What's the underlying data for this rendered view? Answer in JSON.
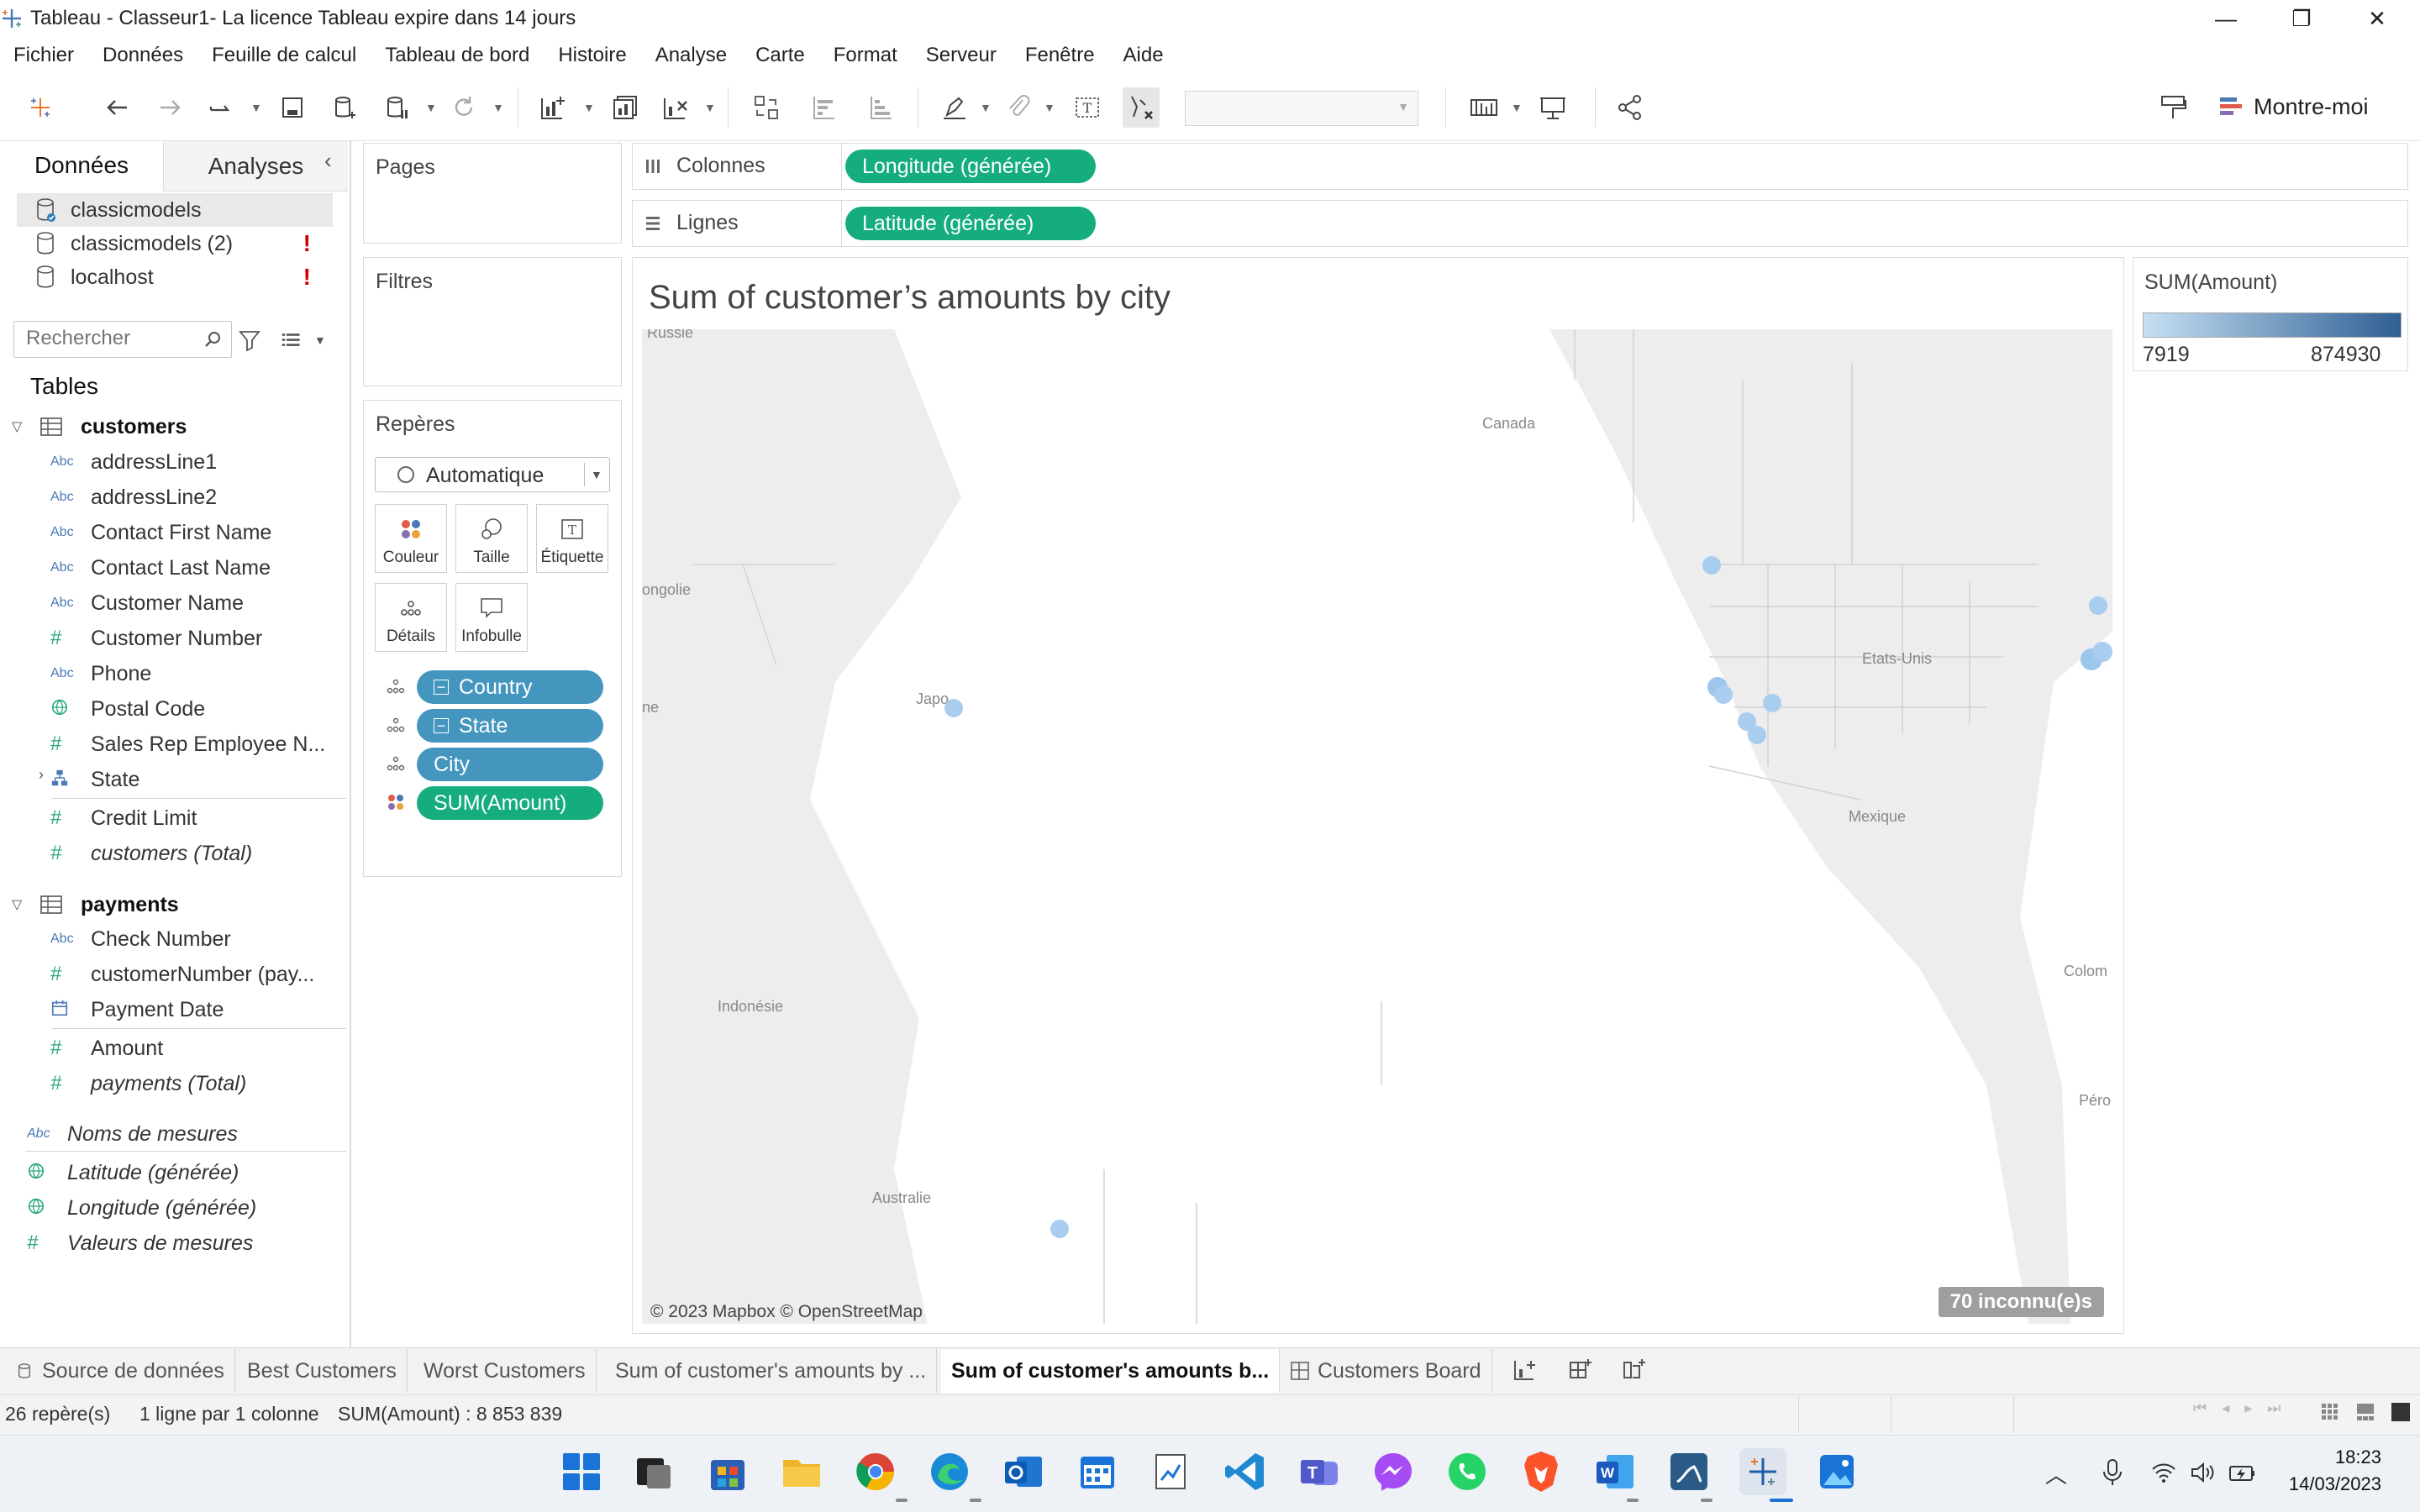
{
  "window": {
    "title": "Tableau - Classeur1- La licence Tableau expire dans 14 jours"
  },
  "menu": [
    "Fichier",
    "Données",
    "Feuille de calcul",
    "Tableau de bord",
    "Histoire",
    "Analyse",
    "Carte",
    "Format",
    "Serveur",
    "Fenêtre",
    "Aide"
  ],
  "toolbar": {
    "show_me": "Montre-moi"
  },
  "left_panel": {
    "tab_data": "Données",
    "tab_analytics": "Analyses",
    "datasources": [
      {
        "name": "classicmodels",
        "selected": true,
        "warning": ""
      },
      {
        "name": "classicmodels (2)",
        "selected": false,
        "warning": "!"
      },
      {
        "name": "localhost",
        "selected": false,
        "warning": "!"
      }
    ],
    "search_placeholder": "Rechercher",
    "tables_label": "Tables",
    "customers": {
      "name": "customers",
      "fields": [
        {
          "type": "Abc",
          "name": "addressLine1"
        },
        {
          "type": "Abc",
          "name": "addressLine2"
        },
        {
          "type": "Abc",
          "name": "Contact First Name"
        },
        {
          "type": "Abc",
          "name": "Contact Last Name"
        },
        {
          "type": "Abc",
          "name": "Customer Name"
        },
        {
          "type": "#",
          "name": "Customer Number"
        },
        {
          "type": "Abc",
          "name": "Phone"
        },
        {
          "type": "globe",
          "name": "Postal Code"
        },
        {
          "type": "#",
          "name": "Sales Rep Employee N..."
        },
        {
          "type": "hier",
          "name": "State"
        }
      ],
      "measures": [
        {
          "type": "#",
          "name": "Credit Limit"
        },
        {
          "type": "#",
          "name": "customers (Total)"
        }
      ]
    },
    "payments": {
      "name": "payments",
      "fields": [
        {
          "type": "Abc",
          "name": "Check Number"
        },
        {
          "type": "#",
          "name": "customerNumber (pay..."
        },
        {
          "type": "date",
          "name": "Payment Date"
        }
      ],
      "measures": [
        {
          "type": "#",
          "name": "Amount"
        },
        {
          "type": "#",
          "name": "payments (Total)"
        }
      ]
    },
    "extra": [
      {
        "type": "Abc",
        "name": "Noms de mesures"
      },
      {
        "type": "globe",
        "name": "Latitude (générée)"
      },
      {
        "type": "globe",
        "name": "Longitude (générée)"
      },
      {
        "type": "#",
        "name": "Valeurs de mesures"
      }
    ]
  },
  "shelves": {
    "pages": "Pages",
    "filters": "Filtres",
    "marks": "Repères",
    "mark_type": "Automatique",
    "buttons": [
      "Couleur",
      "Taille",
      "Étiquette",
      "Détails",
      "Infobulle"
    ],
    "mark_pills": [
      "Country",
      "State",
      "City",
      "SUM(Amount)"
    ],
    "columns_label": "Colonnes",
    "rows_label": "Lignes",
    "columns_pill": "Longitude (générée)",
    "rows_pill": "Latitude (générée)"
  },
  "viz": {
    "title": "Sum of customer’s amounts by city",
    "map_labels": [
      "Russie",
      "Canada",
      "ongolie",
      "Etats-Unis",
      "Japo",
      "ne",
      "Mexique",
      "Colom",
      "Indonésie",
      "Péro",
      "Australie"
    ],
    "attribution": "© 2023 Mapbox © OpenStreetMap",
    "unknown": "70 inconnu(e)s"
  },
  "legend": {
    "title": "SUM(Amount)",
    "min": "7919",
    "max": "874930",
    "color_low": "#c6e0f4",
    "color_high": "#2f5f93"
  },
  "sheet_tabs": [
    {
      "label": "Source de données",
      "active": false
    },
    {
      "label": "Best Customers",
      "active": false
    },
    {
      "label": "Worst Customers",
      "active": false
    },
    {
      "label": "Sum of customer's amounts by ...",
      "active": false
    },
    {
      "label": "Sum of customer's amounts b...",
      "active": true
    },
    {
      "label": "Customers Board",
      "active": false
    }
  ],
  "status": {
    "marks": "26 repère(s)",
    "rows_cols": "1 ligne par 1 colonne",
    "sum": "SUM(Amount) : 8 853 839"
  },
  "taskbar": {
    "time": "18:23",
    "date": "14/03/2023"
  },
  "colors": {
    "dimension_pill": "#4496bf",
    "measure_pill": "#15ad7e",
    "map_background": "#ededed"
  }
}
